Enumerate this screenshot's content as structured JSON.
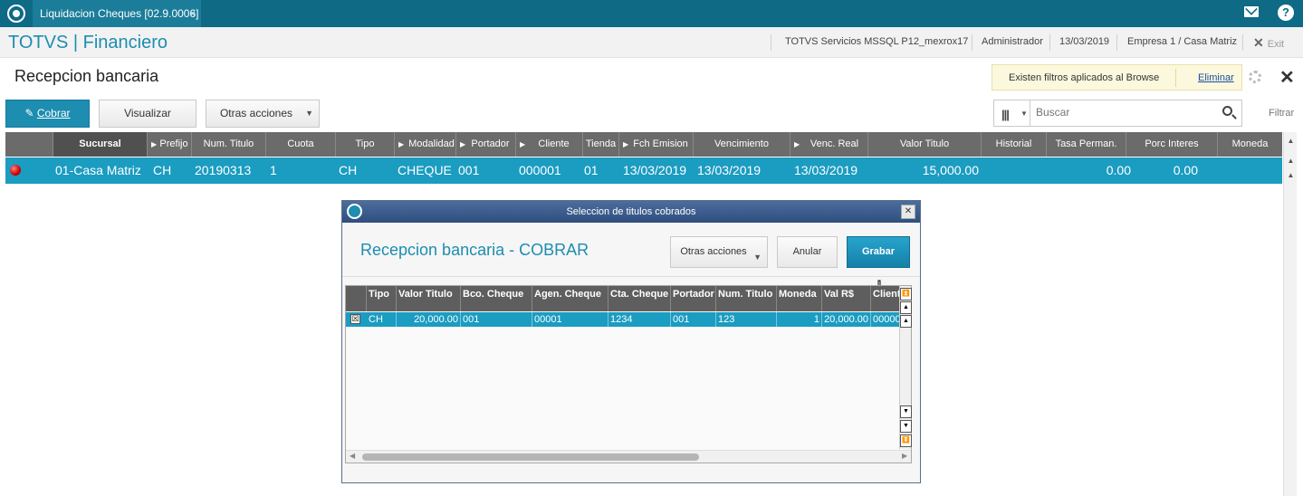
{
  "topbar": {
    "tab_label": "Liquidacion Cheques [02.9.0006]",
    "tab_close": "×",
    "icons": [
      "totvs-logo-icon",
      "mail-icon",
      "help-icon"
    ]
  },
  "header": {
    "app_title": "TOTVS | Financiero",
    "environment": "TOTVS Servicios MSSQL P12_mexrox17",
    "user": "Administrador",
    "date": "13/03/2019",
    "company": "Empresa 1 / Casa Matriz",
    "exit_label": "Exit"
  },
  "page": {
    "title": "Recepcion bancaria",
    "filter_notice": "Existen filtros aplicados al Browse",
    "filter_clear": "Eliminar"
  },
  "toolbar": {
    "cobrar": "Cobrar",
    "visualizar": "Visualizar",
    "otras": "Otras acciones"
  },
  "search": {
    "placeholder": "Buscar",
    "filtrar": "Filtrar"
  },
  "browse": {
    "columns": [
      "Sucursal",
      "Prefijo",
      "Num. Titulo",
      "Cuota",
      "Tipo",
      "Modalidad",
      "Portador",
      "Cliente",
      "Tienda",
      "Fch Emision",
      "Vencimiento",
      "Venc. Real",
      "Valor Titulo",
      "Historial",
      "Tasa Perman.",
      "Porc Interes",
      "Moneda"
    ],
    "row": {
      "sucursal": "01-Casa Matriz",
      "prefijo": "CH",
      "num_titulo": "20190313",
      "cuota": "1",
      "tipo": "CH",
      "modalidad": "CHEQUE",
      "portador": "001",
      "cliente": "000001",
      "tienda": "01",
      "fch_emision": "13/03/2019",
      "vencimiento": "13/03/2019",
      "venc_real": "13/03/2019",
      "valor_titulo": "15,000.00",
      "tasa_perman": "0.00",
      "porc_interes": "0.00"
    }
  },
  "dialog": {
    "window_title": "Seleccion de titulos cobrados",
    "heading": "Recepcion bancaria - COBRAR",
    "otras": "Otras acciones",
    "anular": "Anular",
    "grabar": "Grabar",
    "columns": [
      "Tipo",
      "Valor Titulo",
      "Bco. Cheque",
      "Agen. Cheque",
      "Cta. Cheque",
      "Portador",
      "Num. Titulo",
      "Moneda",
      "Val R$",
      "Client"
    ],
    "row": {
      "check": "☒",
      "tipo": "CH",
      "valor_titulo": "20,000.00",
      "bco_cheque": "001",
      "agen_cheque": "00001",
      "cta_cheque": "1234",
      "portador": "001",
      "num_titulo": "123",
      "moneda": "1",
      "val_rs": "20,000.00",
      "cliente": "00000"
    }
  }
}
